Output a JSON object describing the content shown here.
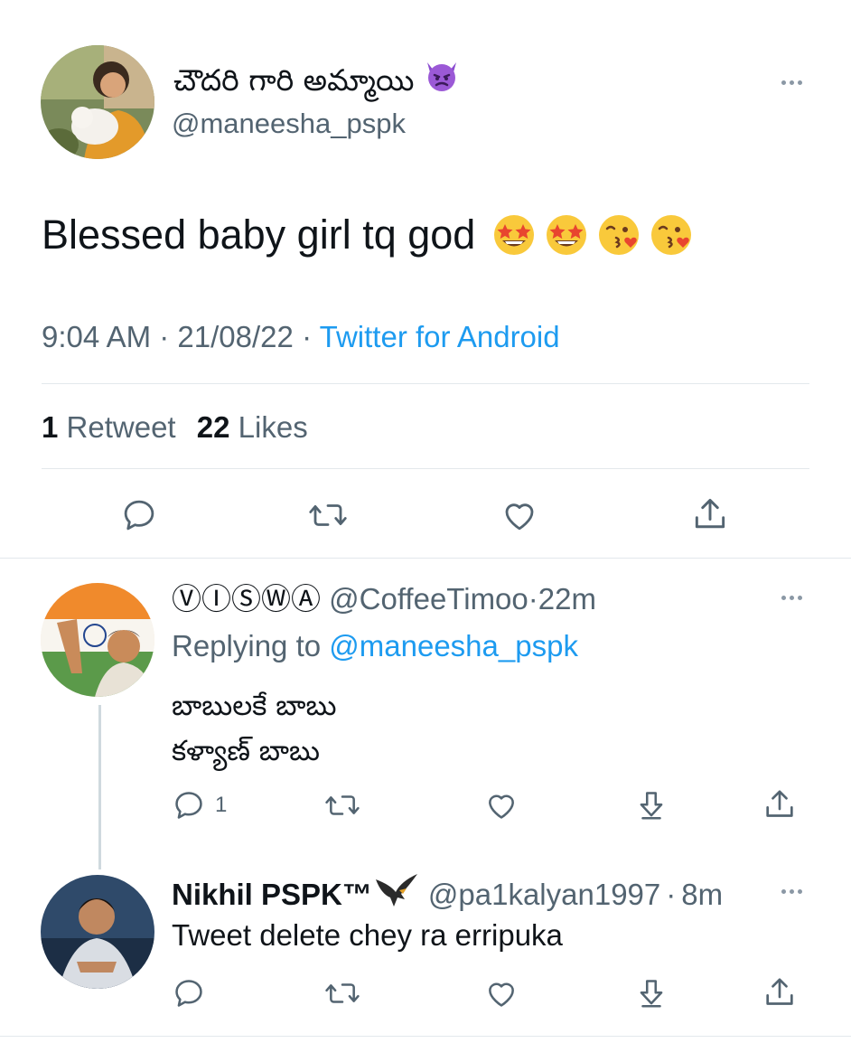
{
  "tweet": {
    "display_name": "చౌదరి గారి అమ్మాయి",
    "name_emoji_icon": "smiling-devil-icon",
    "handle": "@maneesha_pspk",
    "text": "Blessed baby girl tq god",
    "text_emojis": [
      "star-struck-icon",
      "star-struck-icon",
      "kissing-heart-icon",
      "kissing-heart-icon"
    ],
    "time": "9:04 AM",
    "dot1": "·",
    "date": "21/08/22",
    "dot2": "·",
    "source": "Twitter for Android",
    "retweet_count": "1",
    "retweet_label": "Retweet",
    "like_count": "22",
    "like_label": "Likes"
  },
  "replies": [
    {
      "display_name": "ⓋⒾⓈⓌⒶ",
      "handle": "@CoffeeTimoo",
      "dot": "·",
      "time": "22m",
      "replying_to_label": "Replying to",
      "replying_to_handle": "@maneesha_pspk",
      "line1": "బాబులకే బాబు",
      "line2": "కళ్యాణ్ బాబు",
      "reply_count": "1"
    },
    {
      "display_name": "Nikhil PSPK™",
      "name_emoji_icon": "eagle-icon",
      "handle": "@pa1kalyan1997",
      "dot": "·",
      "time": "8m",
      "text": "Tweet delete chey ra erripuka"
    }
  ],
  "colors": {
    "text": "#0f1419",
    "secondary": "#536471",
    "link": "#1d9bf0",
    "divider": "#e3e8ec",
    "icon": "#536471"
  }
}
